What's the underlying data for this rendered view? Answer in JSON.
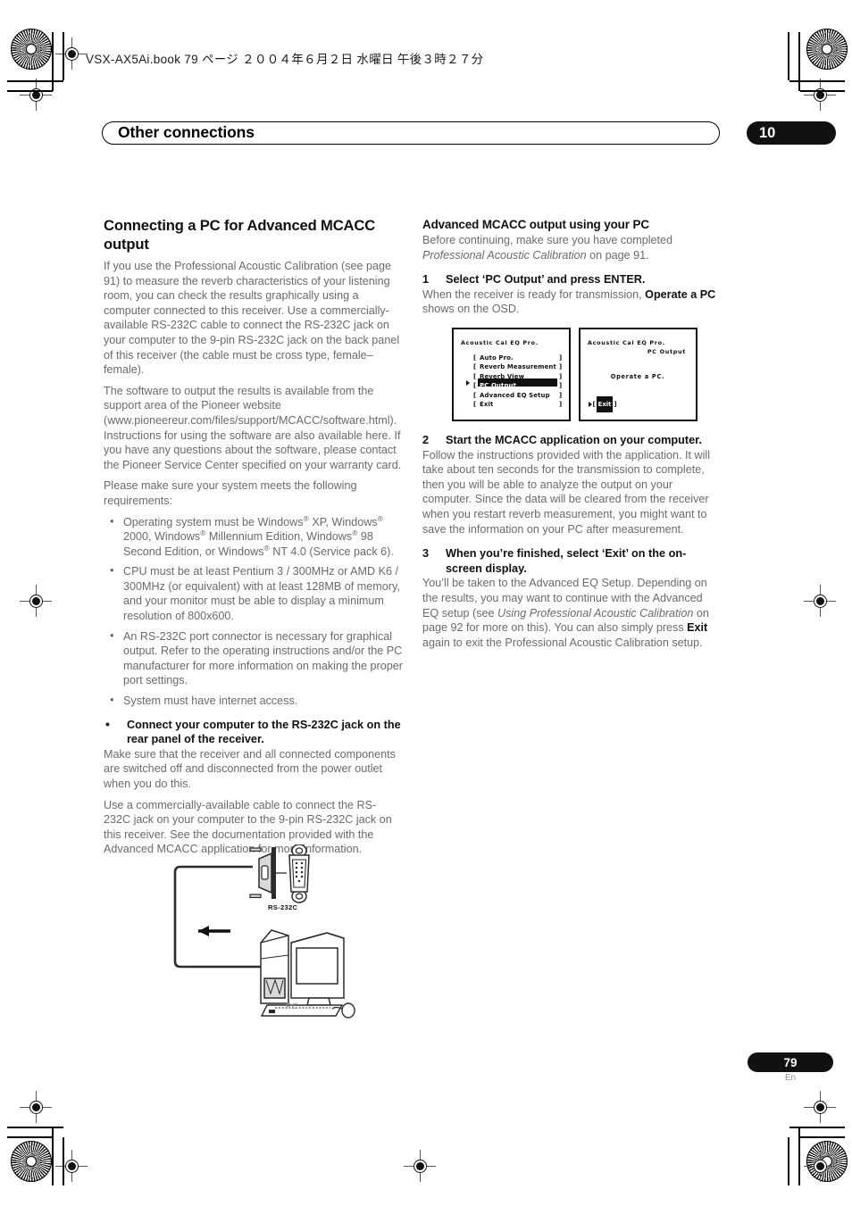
{
  "printer_header": "VSX-AX5Ai.book  79 ページ  ２００４年６月２日  水曜日  午後３時２７分",
  "chapter": {
    "title": "Other connections",
    "number": "10"
  },
  "left_column": {
    "heading": "Connecting a PC for Advanced MCACC output",
    "para1": "If you use the Professional Acoustic Calibration (see page 91) to measure the reverb characteristics of your listening room, you can check the results graphically using a computer connected to this receiver. Use a commercially-available RS-232C cable to connect the RS-232C jack on your computer to the 9-pin RS-232C jack on the back panel of this receiver (the cable must be cross type, female–female).",
    "para2": "The software to output the results is available from the support area of the Pioneer website (www.pioneereur.com/files/support/MCACC/software.html). Instructions for using the software are also available here. If you have any questions about the software, please contact the Pioneer Service Center specified on your warranty card.",
    "para3": "Please make sure your system meets the following requirements:",
    "requirements": [
      "Operating system must be Windows® XP, Windows® 2000, Windows® Millennium Edition, Windows® 98 Second Edition, or Windows® NT 4.0 (Service pack 6).",
      "CPU must be at least Pentium 3 / 300MHz or AMD K6 / 300MHz (or equivalent) with at least 128MB of memory, and your monitor must be able to display a minimum resolution of 800x600.",
      "An RS-232C port connector is necessary for graphical output. Refer to the operating instructions and/or the PC manufacturer for more information on making the proper port settings.",
      "System must have internet access."
    ],
    "bold_bullet": "Connect your computer to the RS-232C jack on the rear panel of the receiver.",
    "para4": "Make sure that the receiver and all connected components are switched off and disconnected from the power outlet when you do this.",
    "para5": "Use a commercially-available cable to connect the RS-232C jack on your computer to the 9-pin RS-232C jack on this receiver. See the documentation provided with the Advanced MCACC application for more information."
  },
  "right_column": {
    "heading": "Advanced MCACC output using your PC",
    "intro_a": "Before continuing, make sure you have completed ",
    "intro_italic": "Professional Acoustic Calibration",
    "intro_b": " on page 91.",
    "step1": {
      "num": "1",
      "title": "Select ‘PC Output’ and press ENTER.",
      "body_a": "When the receiver is ready for transmission, ",
      "body_bold": "Operate a PC",
      "body_b": " shows on the OSD."
    },
    "step2": {
      "num": "2",
      "title": "Start the MCACC application on your computer.",
      "body": "Follow the instructions provided with the application. It will take about ten seconds for the transmission to complete, then you will be able to analyze the output on your computer. Since the data will be cleared from the receiver when you restart reverb measurement, you might want to save the information on your PC after measurement."
    },
    "step3": {
      "num": "3",
      "title": "When you’re finished, select ‘Exit’ on the on-screen display.",
      "body_a": "You’ll be taken to the Advanced EQ Setup. Depending on the results, you may want to continue with the Advanced EQ setup (see ",
      "body_italic": "Using Professional Acoustic Calibration",
      "body_b": " on page 92 for more on this). You can also simply press ",
      "body_bold": "Exit",
      "body_c": " again to exit the Professional Acoustic Calibration setup."
    }
  },
  "osd_screen_1": {
    "title": "Acoustic  Cal  EQ  Pro.",
    "bracket_left": "[",
    "bracket_right": "]",
    "items": [
      {
        "label": "Auto Pro.",
        "selected": false,
        "cursor": false
      },
      {
        "label": "Reverb Measurement",
        "selected": false,
        "cursor": false
      },
      {
        "label": "Reverb View",
        "selected": false,
        "cursor": false
      },
      {
        "label": "PC Output",
        "selected": true,
        "cursor": true
      },
      {
        "label": "Advanced EQ Setup",
        "selected": false,
        "cursor": false
      },
      {
        "label": "Exit",
        "selected": false,
        "cursor": false
      }
    ]
  },
  "osd_screen_2": {
    "title": "Acoustic  Cal  EQ  Pro.",
    "subtitle": "PC Output",
    "message": "Operate  a  PC.",
    "exit_label": "Exit",
    "bracket_left": "[",
    "bracket_right": "]"
  },
  "diagram": {
    "connector_label": "RS-232C",
    "pc_label": "PC"
  },
  "footer": {
    "page_number": "79",
    "language": "En"
  }
}
